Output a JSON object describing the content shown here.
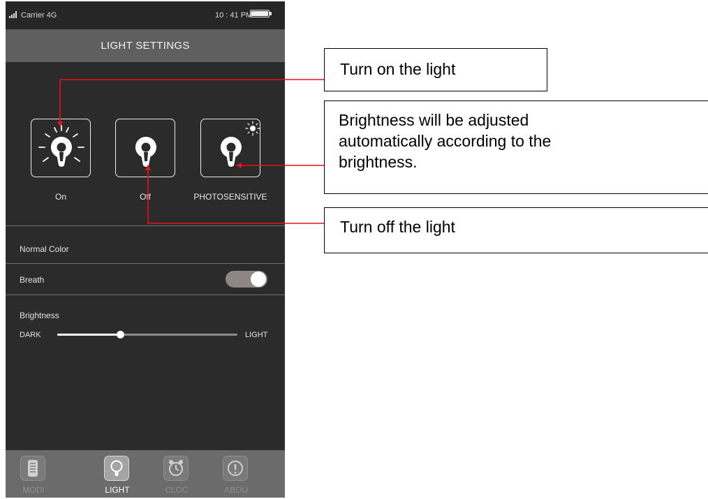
{
  "status": {
    "carrier": "Carrier 4G",
    "time": "10 : 41 PM"
  },
  "header": {
    "title": "LIGHT SETTINGS"
  },
  "modes": [
    {
      "label": "On",
      "icon": "bulb-rays-icon"
    },
    {
      "label": "Off",
      "icon": "bulb-icon"
    },
    {
      "label": "PHOTOSENSITIVE",
      "icon": "bulb-sun-icon"
    }
  ],
  "settings": {
    "normal_color": "Normal Color",
    "breath": "Breath",
    "breath_on": true,
    "brightness": "Brightness",
    "dark": "DARK",
    "light": "LIGHT",
    "brightness_level": 0.35
  },
  "tabs": [
    {
      "label": "MODI",
      "icon": "document-icon",
      "active": false
    },
    {
      "label": "LIGHT",
      "icon": "bulb-icon",
      "active": true
    },
    {
      "label": "CLOC",
      "icon": "alarm-clock-icon",
      "active": false
    },
    {
      "label": "ABOU",
      "icon": "info-icon",
      "active": false
    }
  ],
  "callouts": {
    "on": "Turn on the light",
    "photo_line1": "Brightness will be adjusted",
    "photo_line2": "automatically according to the",
    "photo_line3": "brightness.",
    "off": "Turn off the light"
  },
  "colors": {
    "annotation": "#e8121a",
    "toggle_track": "#8d8682"
  }
}
